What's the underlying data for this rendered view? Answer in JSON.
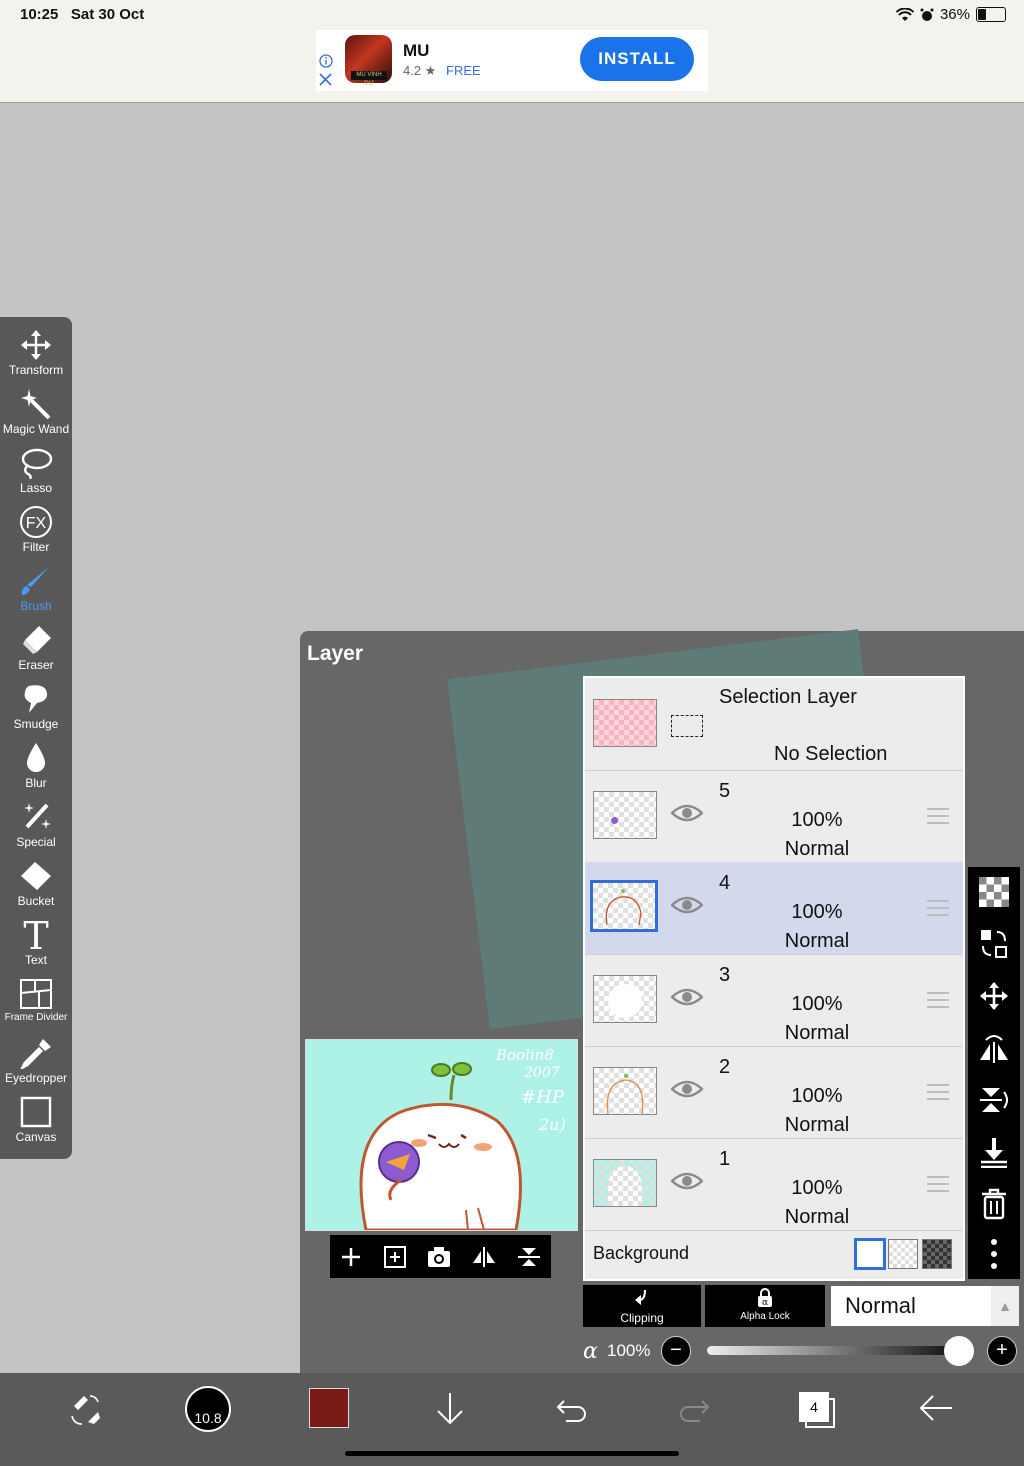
{
  "status": {
    "time": "10:25",
    "date": "Sat 30 Oct",
    "battery": "36%"
  },
  "ad": {
    "app_name": "MU",
    "rating": "4.2 ★",
    "price": "FREE",
    "install_label": "INSTALL",
    "icon_text": "MU VINH DỰ"
  },
  "toolbar": {
    "active_tool": "Brush",
    "tools": [
      "Transform",
      "Magic Wand",
      "Lasso",
      "Filter",
      "Brush",
      "Eraser",
      "Smudge",
      "Blur",
      "Special",
      "Bucket",
      "Text",
      "Frame Divider",
      "Eyedropper",
      "Canvas"
    ],
    "accent_color": "#4a9bf0"
  },
  "layer_panel": {
    "title": "Layer",
    "selection_layer": {
      "label": "Selection Layer",
      "status": "No Selection"
    },
    "layers": [
      {
        "number": "5",
        "opacity": "100%",
        "mode": "Normal",
        "selected": false
      },
      {
        "number": "4",
        "opacity": "100%",
        "mode": "Normal",
        "selected": true
      },
      {
        "number": "3",
        "opacity": "100%",
        "mode": "Normal",
        "selected": false
      },
      {
        "number": "2",
        "opacity": "100%",
        "mode": "Normal",
        "selected": false
      },
      {
        "number": "1",
        "opacity": "100%",
        "mode": "Normal",
        "selected": false
      }
    ],
    "background_label": "Background",
    "preview_text": [
      "Boolin8",
      "2007",
      "#HP",
      "2u)"
    ]
  },
  "blend": {
    "clipping_label": "Clipping",
    "alpha_lock_label": "Alpha Lock",
    "mode": "Normal",
    "alpha_symbol": "α",
    "opacity": "100%"
  },
  "bottombar": {
    "brush_size": "10.8",
    "color": "#7a1a14",
    "layer_count": "4"
  }
}
